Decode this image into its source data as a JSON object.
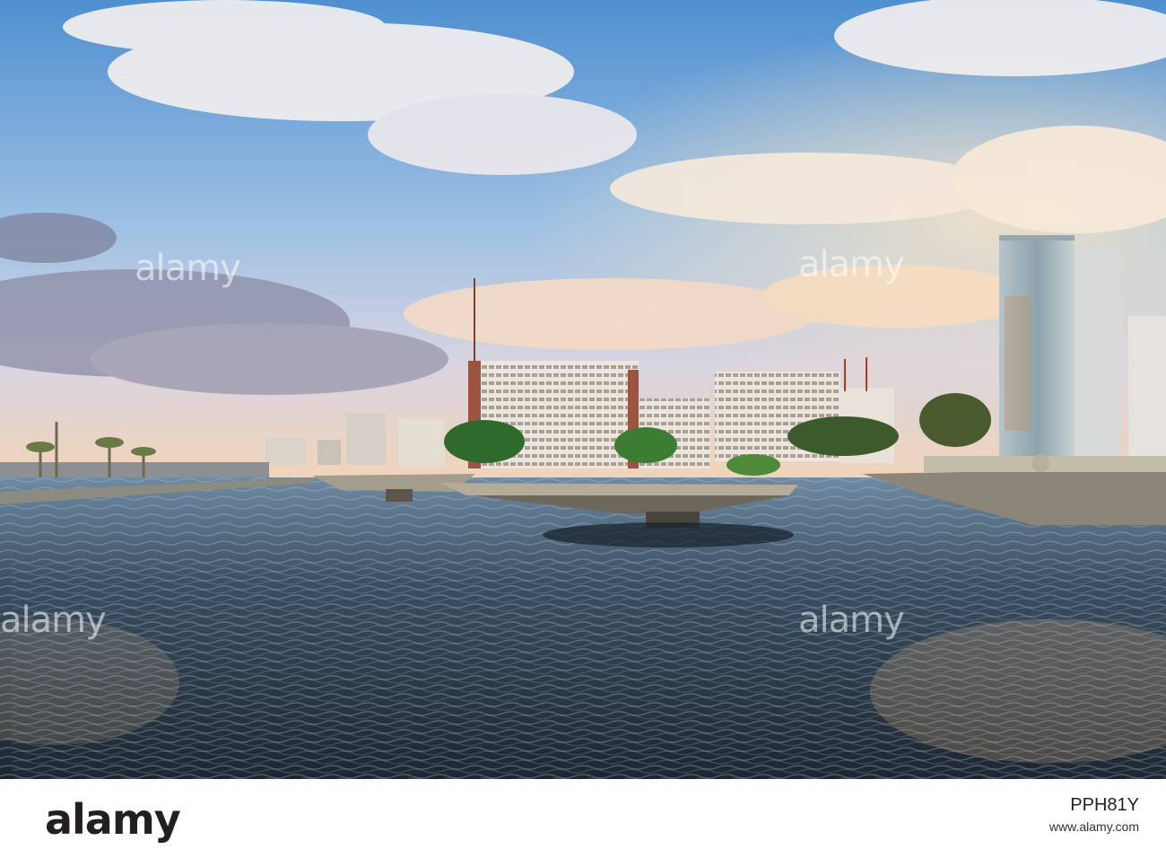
{
  "watermark": {
    "text": "alamy"
  },
  "footer": {
    "logo_text": "alamy",
    "image_id": "PPH81Y",
    "site": "www.alamy.com"
  },
  "colors": {
    "sky_top": "#5b97d1",
    "sky_mid": "#a9c8e6",
    "horizon": "#f0c9a4",
    "water_dark": "#1f2a34",
    "water_light": "#6f8aa3",
    "building_light": "#e7e0d6",
    "tree_green": "#2f6a2c"
  }
}
